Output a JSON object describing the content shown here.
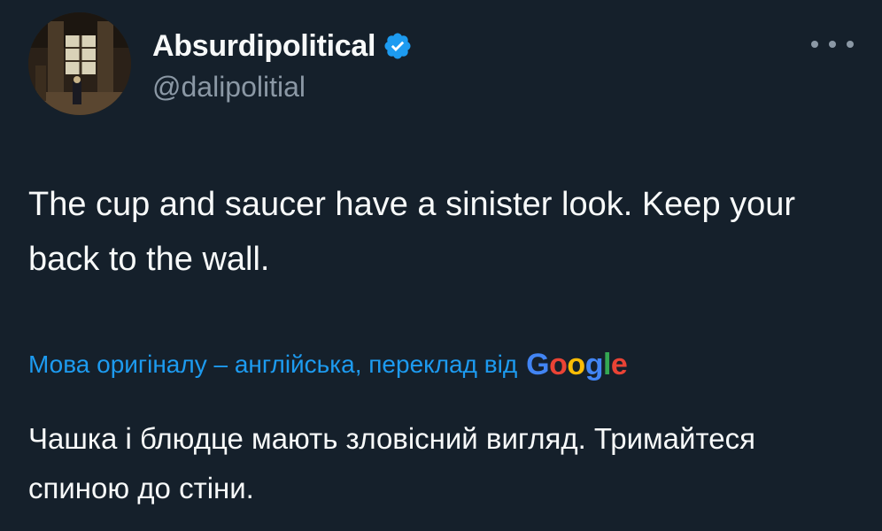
{
  "author": {
    "display_name": "Absurdipolitical",
    "handle": "@dalipolitial",
    "verified": true,
    "avatar_icon": "painting-avatar"
  },
  "menu": {
    "more_icon": "more-horizontal-icon"
  },
  "tweet": {
    "text": "The cup and saucer have a sinister look. Keep your back to the wall."
  },
  "translation": {
    "label": "Мова оригіналу – англійська, переклад від",
    "provider_letters": [
      "G",
      "o",
      "o",
      "g",
      "l",
      "e"
    ],
    "text": "Чашка і блюдце мають зловісний вигляд. Тримайтеся спиною до стіни."
  },
  "colors": {
    "background": "#15202b",
    "primary_text": "#f7f9f9",
    "secondary_text": "#8b98a5",
    "link": "#1d9bf0",
    "verified": "#1d9bf0"
  }
}
